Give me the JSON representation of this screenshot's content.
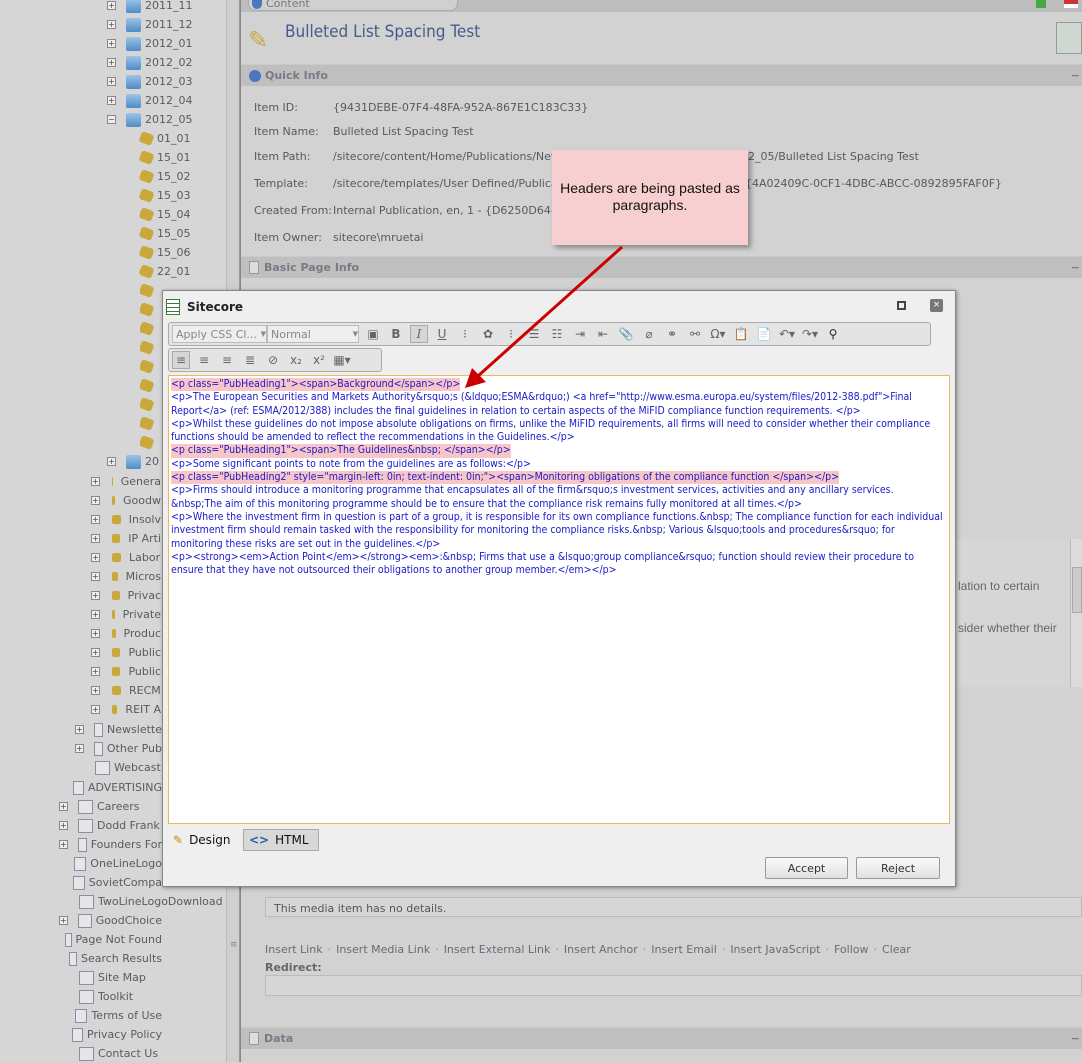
{
  "tree": {
    "folders": [
      "2011_11",
      "2011_12",
      "2012_01",
      "2012_02",
      "2012_03",
      "2012_04",
      "2012_05"
    ],
    "items": [
      "01_01",
      "15_01",
      "15_02",
      "15_03",
      "15_04",
      "15_05",
      "15_06",
      "22_01"
    ],
    "collapsed_year": "20",
    "categories": [
      "Genera",
      "Goodw",
      "Insolv",
      "IP Arti",
      "Labor",
      "Micros",
      "Privac",
      "Private",
      "Produc",
      "Public",
      "Public",
      "RECM",
      "REIT A"
    ],
    "pubs": [
      {
        "label": "Newslette",
        "expand": true
      },
      {
        "label": "Other Pub",
        "expand": true
      },
      {
        "label": "Webcast",
        "expand": false
      }
    ],
    "root": [
      {
        "label": "ADVERTISING",
        "expand": false
      },
      {
        "label": "Careers",
        "expand": true
      },
      {
        "label": "Dodd Frank",
        "expand": true
      },
      {
        "label": "Founders For",
        "expand": true
      },
      {
        "label": "OneLineLogo",
        "expand": false
      },
      {
        "label": "SovietCompa",
        "expand": false
      },
      {
        "label": "TwoLineLogoDownload",
        "expand": false
      },
      {
        "label": "GoodChoice",
        "expand": true
      },
      {
        "label": "Page Not Found",
        "expand": false
      },
      {
        "label": "Search Results",
        "expand": false
      },
      {
        "label": "Site Map",
        "expand": false
      },
      {
        "label": "Toolkit",
        "expand": false
      },
      {
        "label": "Terms of Use",
        "expand": false
      },
      {
        "label": "Privacy Policy",
        "expand": false
      },
      {
        "label": "Contact Us",
        "expand": false
      }
    ]
  },
  "content": {
    "tab": "Content",
    "title": "Bulleted List Spacing Test",
    "quick_info": {
      "header": "Quick Info",
      "rows": [
        {
          "label": "Item ID:",
          "value": "{9431DEBE-07F4-48FA-952A-867E1C183C33}"
        },
        {
          "label": "Item Name:",
          "value": "Bulleted List Spacing Test"
        },
        {
          "label": "Item Path:",
          "value": "/sitecore/content/Home/Publications/Newslett",
          "value2": "2_05/Bulleted List Spacing Test"
        },
        {
          "label": "Template:",
          "value": "/sitecore/templates/User Defined/Publications",
          "value2": "{4A02409C-0CF1-4DBC-ABCC-0892895FAF0F}"
        },
        {
          "label": "Created From:",
          "value": "Internal Publication, en, 1 - {D6250D64-0A01"
        },
        {
          "label": "Item Owner:",
          "value": "sitecore\\mruetai"
        }
      ]
    },
    "basic_page_info": "Basic Page Info",
    "bg_text1": "lation to certain",
    "bg_text2": "sider whether their",
    "media_note": "This media item has no details.",
    "link_actions": [
      "Insert Link",
      "Insert Media Link",
      "Insert External Link",
      "Insert Anchor",
      "Insert Email",
      "Insert JavaScript",
      "Follow",
      "Clear"
    ],
    "redirect_label": "Redirect:",
    "data_header": "Data"
  },
  "callout": {
    "text": "Headers are being pasted as paragraphs.",
    "arrow_color": "#cc0000"
  },
  "dialog": {
    "title": "Sitecore",
    "css_class_select": "Apply CSS Cl...",
    "format_select": "Normal",
    "lines": [
      {
        "t": "<p class=\"PubHeading1\"><span>Background</span></p>",
        "hl": true
      },
      {
        "t": "<p>The European Securities and Markets Authority&rsquo;s (&ldquo;ESMA&rdquo;) <a href=\"http://www.esma.europa.eu/system/files/2012-388.pdf\">Final Report</a> (ref: ESMA/2012/388) includes the final guidelines in relation to certain aspects of the MiFID compliance function requirements. </p>",
        "hl": false
      },
      {
        "t": "<p>Whilst these guidelines do not impose absolute obligations on firms, unlike the MiFID requirements, all firms will need to consider whether their compliance functions should be amended to reflect the recommendations in the Guidelines.</p>",
        "hl": false
      },
      {
        "t": "<p class=\"PubHeading1\"><span>The Guidelines&nbsp; </span></p>",
        "hl": true
      },
      {
        "t": "<p>Some significant points to note from the guidelines are as follows:</p>",
        "hl": false
      },
      {
        "t": "<p class=\"PubHeading2\" style=\"margin-left: 0in; text-indent: 0in;\"><span>Monitoring obligations of the compliance function </span></p>",
        "hl": true
      },
      {
        "t": "<p>Firms should introduce a monitoring programme that encapsulates all of the firm&rsquo;s investment services, activities and any ancillary services. &nbsp;The aim of this monitoring programme should be to ensure that the compliance risk remains fully monitored at all times.</p>",
        "hl": false
      },
      {
        "t": "<p>Where the investment firm in question is part of a group, it is responsible for its own compliance functions.&nbsp; The compliance function for each individual investment firm should remain tasked with the responsibility for monitoring the compliance risks.&nbsp; Various &lsquo;tools and procedures&rsquo; for monitoring these risks are set out in the guidelines.</p>",
        "hl": false
      },
      {
        "t": "<p><strong><em>Action Point</em></strong><em>:&nbsp; Firms that use a &lsquo;group compliance&rsquo; function should review their procedure to ensure that they have not outsourced their obligations to another group member.</em></p>",
        "hl": false
      }
    ],
    "tab_design": "Design",
    "tab_html": "HTML",
    "accept": "Accept",
    "reject": "Reject"
  }
}
